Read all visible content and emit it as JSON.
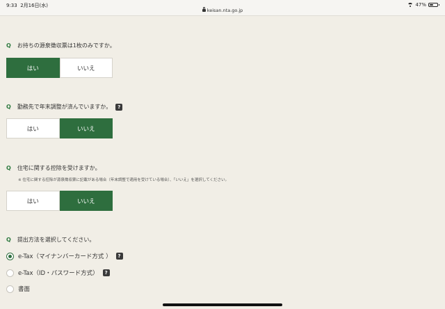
{
  "status_bar": {
    "time": "9:33",
    "date": "2月16日(水)",
    "url": "keisan.nta.go.jp",
    "battery": "47%",
    "battery_level": 0.47
  },
  "q_marker": "Q",
  "questions": [
    {
      "text": "お持ちの源泉徴収票は1枚のみですか。",
      "options": [
        "はい",
        "いいえ"
      ],
      "selected": 0
    },
    {
      "text": "勤務先で年末調整が済んでいますか。",
      "help": "?",
      "options": [
        "はい",
        "いいえ"
      ],
      "selected": 1
    },
    {
      "text": "住宅に関する控除を受けますか。",
      "note": "※ 住宅に関する控除が源泉徴収票に記載がある場合（年末調整で適用を受けている場合）、「いいえ」を選択してください。",
      "options": [
        "はい",
        "いいえ"
      ],
      "selected": 1
    }
  ],
  "submission": {
    "text": "提出方法を選択してください。",
    "options": [
      {
        "label": "e-Tax（マイナンバーカード方式 ）",
        "help": "?",
        "checked": true
      },
      {
        "label": "e-Tax（ID・パスワード方式）",
        "help": "?",
        "checked": false
      },
      {
        "label": "書面",
        "checked": false
      }
    ]
  }
}
